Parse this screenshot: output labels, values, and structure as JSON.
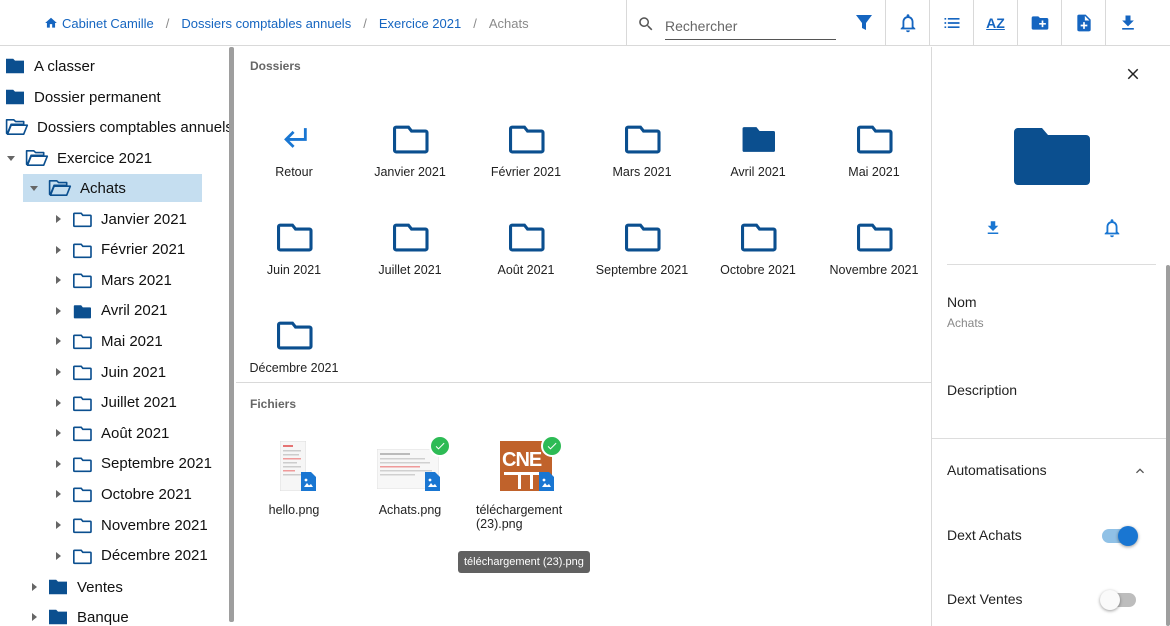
{
  "breadcrumb": {
    "items": [
      "Cabinet Camille",
      "Dossiers comptables annuels",
      "Exercice 2021"
    ],
    "current": "Achats",
    "separator": "/"
  },
  "search": {
    "placeholder": "Rechercher",
    "value": ""
  },
  "toolbar": {
    "icons": [
      "filter-icon",
      "bell-icon",
      "list-view-icon",
      "sort-az-icon",
      "new-folder-icon",
      "new-file-icon",
      "download-icon"
    ],
    "sort_label": "AZ"
  },
  "sidebar": {
    "root_items": [
      "A classer",
      "Dossier permanent",
      "Dossiers comptables annuels"
    ],
    "year": "Exercice 2021",
    "selected": "Achats",
    "months": [
      "Janvier 2021",
      "Février 2021",
      "Mars 2021",
      "Avril 2021",
      "Mai 2021",
      "Juin 2021",
      "Juillet 2021",
      "Août 2021",
      "Septembre 2021",
      "Octobre 2021",
      "Novembre 2021",
      "Décembre 2021"
    ],
    "siblings": [
      "Ventes",
      "Banque"
    ]
  },
  "main": {
    "folders_title": "Dossiers",
    "back_label": "Retour",
    "folders": [
      "Janvier 2021",
      "Février 2021",
      "Mars 2021",
      "Avril 2021",
      "Mai 2021",
      "Juin 2021",
      "Juillet 2021",
      "Août 2021",
      "Septembre 2021",
      "Octobre 2021",
      "Novembre 2021",
      "Décembre 2021"
    ],
    "files_title": "Fichiers",
    "files": [
      {
        "name": "hello.png",
        "checked": false
      },
      {
        "name": "Achats.png",
        "checked": true
      },
      {
        "name": "téléchargement (23).png",
        "checked": true
      }
    ],
    "file_thumb_text": "CNE",
    "tooltip": "téléchargement (23).png"
  },
  "details": {
    "name_label": "Nom",
    "name_value": "Achats",
    "description_label": "Description",
    "automations_label": "Automatisations",
    "automations": [
      {
        "label": "Dext Achats",
        "enabled": true
      },
      {
        "label": "Dext Ventes",
        "enabled": false
      }
    ]
  },
  "colors": {
    "brand": "#0b4f8f",
    "accent": "#1976d2",
    "selected_bg": "#c5def0",
    "check": "#2dbb55"
  }
}
